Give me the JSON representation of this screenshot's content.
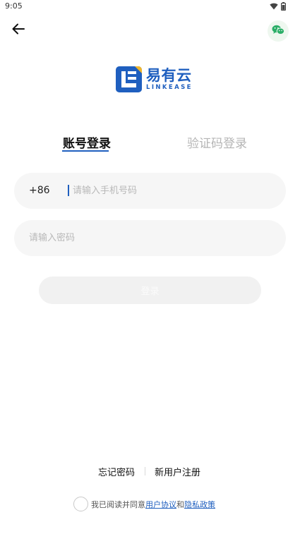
{
  "status_bar": {
    "time": "9:05",
    "icons": [
      "wifi-icon",
      "battery-icon"
    ]
  },
  "header": {
    "back_icon": "arrow-left-icon",
    "wechat_icon": "wechat-icon"
  },
  "logo": {
    "name": "易有云",
    "sub": "LINKEASE"
  },
  "tabs": [
    {
      "label": "账号登录",
      "active": true
    },
    {
      "label": "验证码登录",
      "active": false
    }
  ],
  "phone_field": {
    "country_code": "+86",
    "placeholder": "请输入手机号码",
    "value": ""
  },
  "password_field": {
    "placeholder": "请输入密码",
    "value": ""
  },
  "login_button": {
    "label": "登录"
  },
  "links": {
    "forgot": "忘记密码",
    "register": "新用户注册"
  },
  "agreement": {
    "prefix": "我已阅读并同意",
    "user_agreement": "用户协议",
    "and": "和",
    "privacy_policy": "隐私政策",
    "checked": false
  },
  "colors": {
    "accent": "#1f5fbf",
    "wechat_green": "#2aae67",
    "field_bg": "#f6f6f6",
    "button_disabled_bg": "#f1f1f1",
    "tab_inactive": "#b5b5b5"
  }
}
